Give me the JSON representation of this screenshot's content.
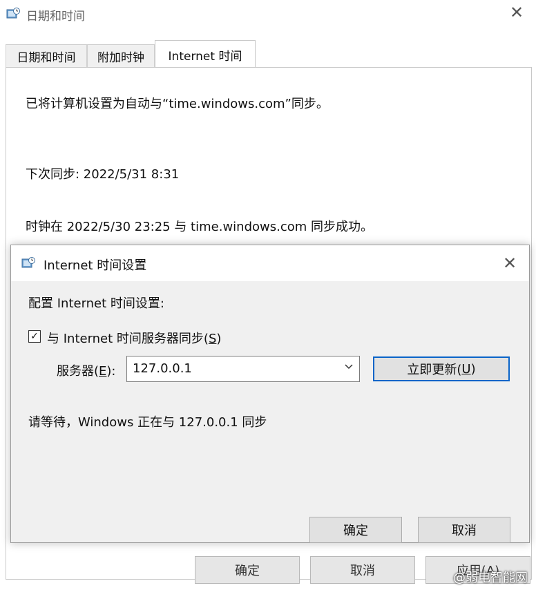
{
  "outer_window": {
    "title": "日期和时间",
    "tabs": [
      {
        "label": "日期和时间",
        "active": false
      },
      {
        "label": "附加时钟",
        "active": false
      },
      {
        "label": "Internet 时间",
        "active": true
      }
    ],
    "panel": {
      "sync_configured_text": "已将计算机设置为自动与“time.windows.com”同步。",
      "next_sync_text": "下次同步: 2022/5/31 8:31",
      "last_sync_text": "时钟在 2022/5/30 23:25 与 time.windows.com 同步成功。"
    },
    "footer": {
      "ok_label": "确定",
      "cancel_label": "取消",
      "apply_label": "应用(A)"
    }
  },
  "dialog": {
    "title": "Internet 时间设置",
    "configure_label": "配置 Internet 时间设置:",
    "sync_checkbox": {
      "checked": true,
      "label_prefix": "与 Internet 时间服务器同步(",
      "accelerator": "S",
      "label_suffix": ")"
    },
    "server": {
      "label_prefix": "服务器(",
      "accelerator": "E",
      "label_suffix": "):",
      "value": "127.0.0.1"
    },
    "update_button": {
      "label_prefix": "立即更新(",
      "accelerator": "U",
      "label_suffix": ")"
    },
    "status_text": "请等待，Windows 正在与 127.0.0.1 同步",
    "ok_label": "确定",
    "cancel_label": "取消"
  },
  "watermark": "@弱电智能网",
  "colors": {
    "dialog_bg": "#f0f0f0",
    "focus_border": "#0a64c8",
    "button_bg": "#e1e1e1"
  }
}
